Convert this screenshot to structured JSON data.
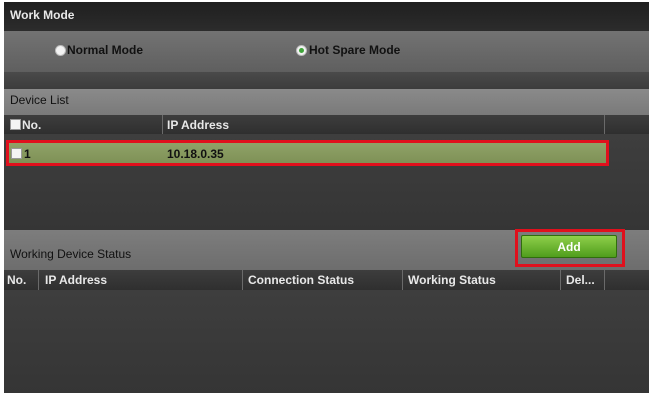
{
  "work_mode": {
    "title": "Work Mode",
    "options": [
      {
        "label": "Normal Mode",
        "selected": false
      },
      {
        "label": "Hot Spare Mode",
        "selected": true
      }
    ]
  },
  "device_list": {
    "title": "Device List",
    "columns": [
      "No.",
      "IP Address"
    ],
    "rows": [
      {
        "no": "1",
        "ip": "10.18.0.35",
        "checked": false,
        "highlighted": true
      }
    ]
  },
  "working_status": {
    "title": "Working Device Status",
    "add_label": "Add",
    "columns": [
      "No.",
      "IP Address",
      "Connection Status",
      "Working Status",
      "Del..."
    ]
  },
  "colors": {
    "row_highlight": "#8fa268",
    "annotation_border": "#e0101d",
    "add_button": "#5aa624"
  }
}
